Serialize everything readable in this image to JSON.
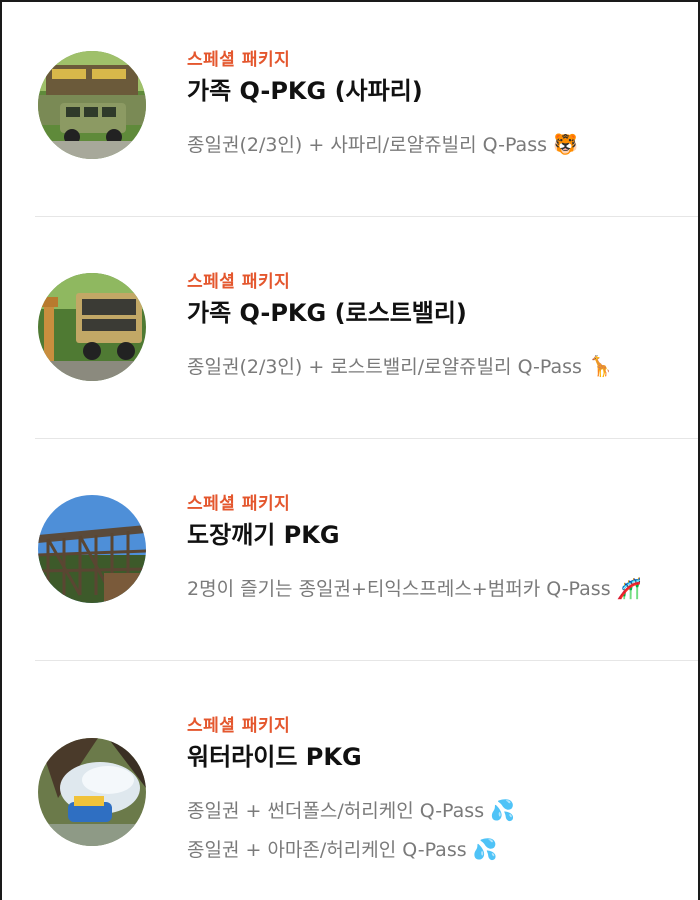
{
  "packages": [
    {
      "tag": "스페셜 패키지",
      "title": "가족 Q-PKG (사파리)",
      "lines": [
        {
          "text": "종일권(2/3인) + 사파리/로얄쥬빌리 Q-Pass",
          "emoji": "🐯"
        }
      ],
      "thumb_icon": "safari-bus-photo"
    },
    {
      "tag": "스페셜 패키지",
      "title": "가족 Q-PKG (로스트밸리)",
      "lines": [
        {
          "text": "종일권(2/3인) + 로스트밸리/로얄쥬빌리 Q-Pass",
          "emoji": "🦒"
        }
      ],
      "thumb_icon": "lost-valley-giraffe-photo"
    },
    {
      "tag": "스페셜 패키지",
      "title": "도장깨기 PKG",
      "lines": [
        {
          "text": "2명이 즐기는 종일권+티익스프레스+범퍼카 Q-Pass",
          "emoji": "🎢"
        }
      ],
      "thumb_icon": "wooden-coaster-photo"
    },
    {
      "tag": "스페셜 패키지",
      "title": "워터라이드 PKG",
      "lines": [
        {
          "text": "종일권 + 썬더폴스/허리케인 Q-Pass",
          "emoji": "💦"
        },
        {
          "text": "종일권 + 아마존/허리케인 Q-Pass",
          "emoji": "💦"
        }
      ],
      "thumb_icon": "water-ride-photo"
    }
  ],
  "colors": {
    "tag": "#e4572e",
    "title": "#111111",
    "desc": "#7a7a7a",
    "divider": "#e6e6e6"
  }
}
